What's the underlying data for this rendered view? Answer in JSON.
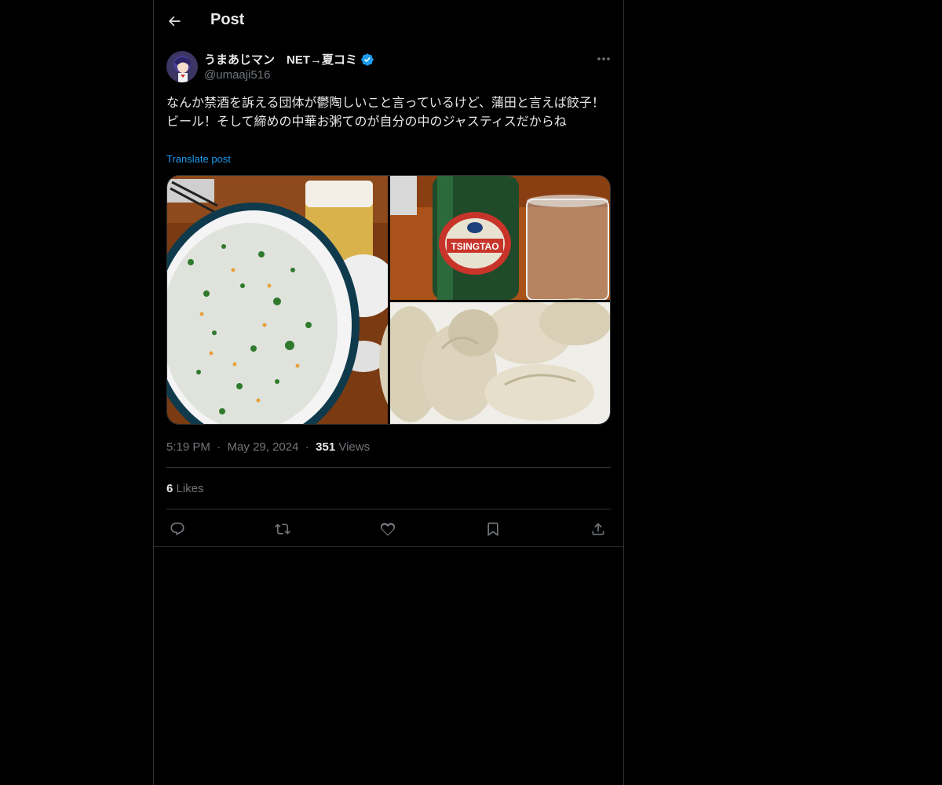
{
  "header": {
    "title": "Post"
  },
  "author": {
    "name": "うまあじマン　NET→夏コミ",
    "handle": "@umaaji516",
    "verified": true
  },
  "post": {
    "text": "なんか禁酒を訴える団体が鬱陶しいこと言っているけど、蒲田と言えば餃子！ビール！そして締めの中華お粥てのが自分の中のジャスティスだからね",
    "translate_label": "Translate post"
  },
  "media": {
    "images": [
      "congee-photo",
      "tsingtao-beer-photo",
      "dumplings-photo"
    ],
    "beer_label": "TSINGTAO"
  },
  "meta": {
    "time": "5:19 PM",
    "date": "May 29, 2024",
    "views_count": "351",
    "views_label": "Views"
  },
  "stats": {
    "likes_count": "6",
    "likes_label": "Likes"
  },
  "actions": [
    "reply-icon",
    "repost-icon",
    "like-icon",
    "bookmark-icon",
    "share-icon"
  ],
  "colors": {
    "accent": "#1d9bf0",
    "muted": "#71767b",
    "text": "#e7e9ea",
    "border": "#2f3336"
  }
}
